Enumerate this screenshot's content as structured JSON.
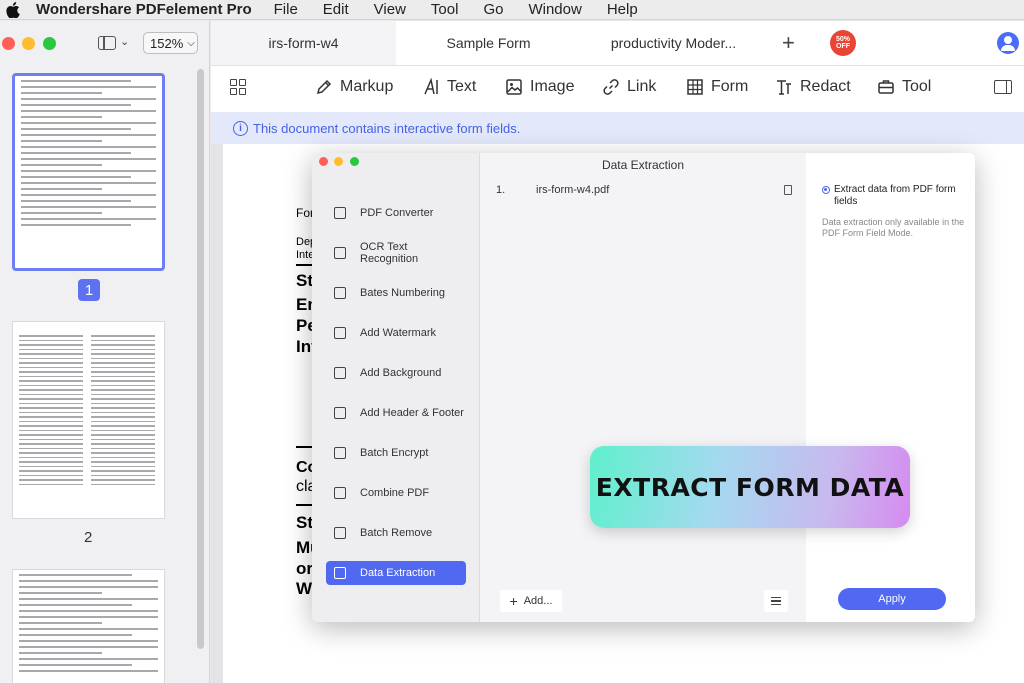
{
  "menubar": {
    "app_name": "Wondershare PDFelement Pro",
    "items": [
      "File",
      "Edit",
      "View",
      "Tool",
      "Go",
      "Window",
      "Help"
    ]
  },
  "left_panel": {
    "zoom": "152%",
    "pages": [
      "1",
      "2"
    ]
  },
  "tabs": {
    "items": [
      "irs-form-w4",
      "Sample Form",
      "productivity Moder..."
    ],
    "active_index": 0,
    "promo_label": "50% OFF"
  },
  "toolbar": {
    "markup": "Markup",
    "text": "Text",
    "image": "Image",
    "link": "Link",
    "form": "Form",
    "redact": "Redact",
    "tool": "Tool"
  },
  "notice": {
    "text": "This document contains interactive form fields."
  },
  "document": {
    "fragments": [
      "Form",
      "Depart",
      "Interna",
      "Step",
      "Ente",
      "Pers",
      "Infor",
      "Com",
      "claim",
      "Step",
      "Mult",
      "or Sp",
      "Work"
    ]
  },
  "dialog": {
    "title": "Data Extraction",
    "side_items": [
      "PDF Converter",
      "OCR Text Recognition",
      "Bates Numbering",
      "Add Watermark",
      "Add Background",
      "Add Header & Footer",
      "Batch Encrypt",
      "Combine PDF",
      "Batch Remove",
      "Data Extraction"
    ],
    "active_side_item": "Data Extraction",
    "files": [
      {
        "num": "1.",
        "name": "irs-form-w4.pdf"
      }
    ],
    "add_label": "Add...",
    "option_label": "Extract data from PDF form fields",
    "option_note": "Data extraction only available in the PDF Form Field Mode.",
    "apply_label": "Apply"
  },
  "banner": {
    "text": "EXTRACT FORM DATA"
  },
  "colors": {
    "accent": "#5069f0",
    "notice_bg": "#e3e8fb",
    "notice_text": "#4562e6",
    "promo": "#e84534"
  }
}
